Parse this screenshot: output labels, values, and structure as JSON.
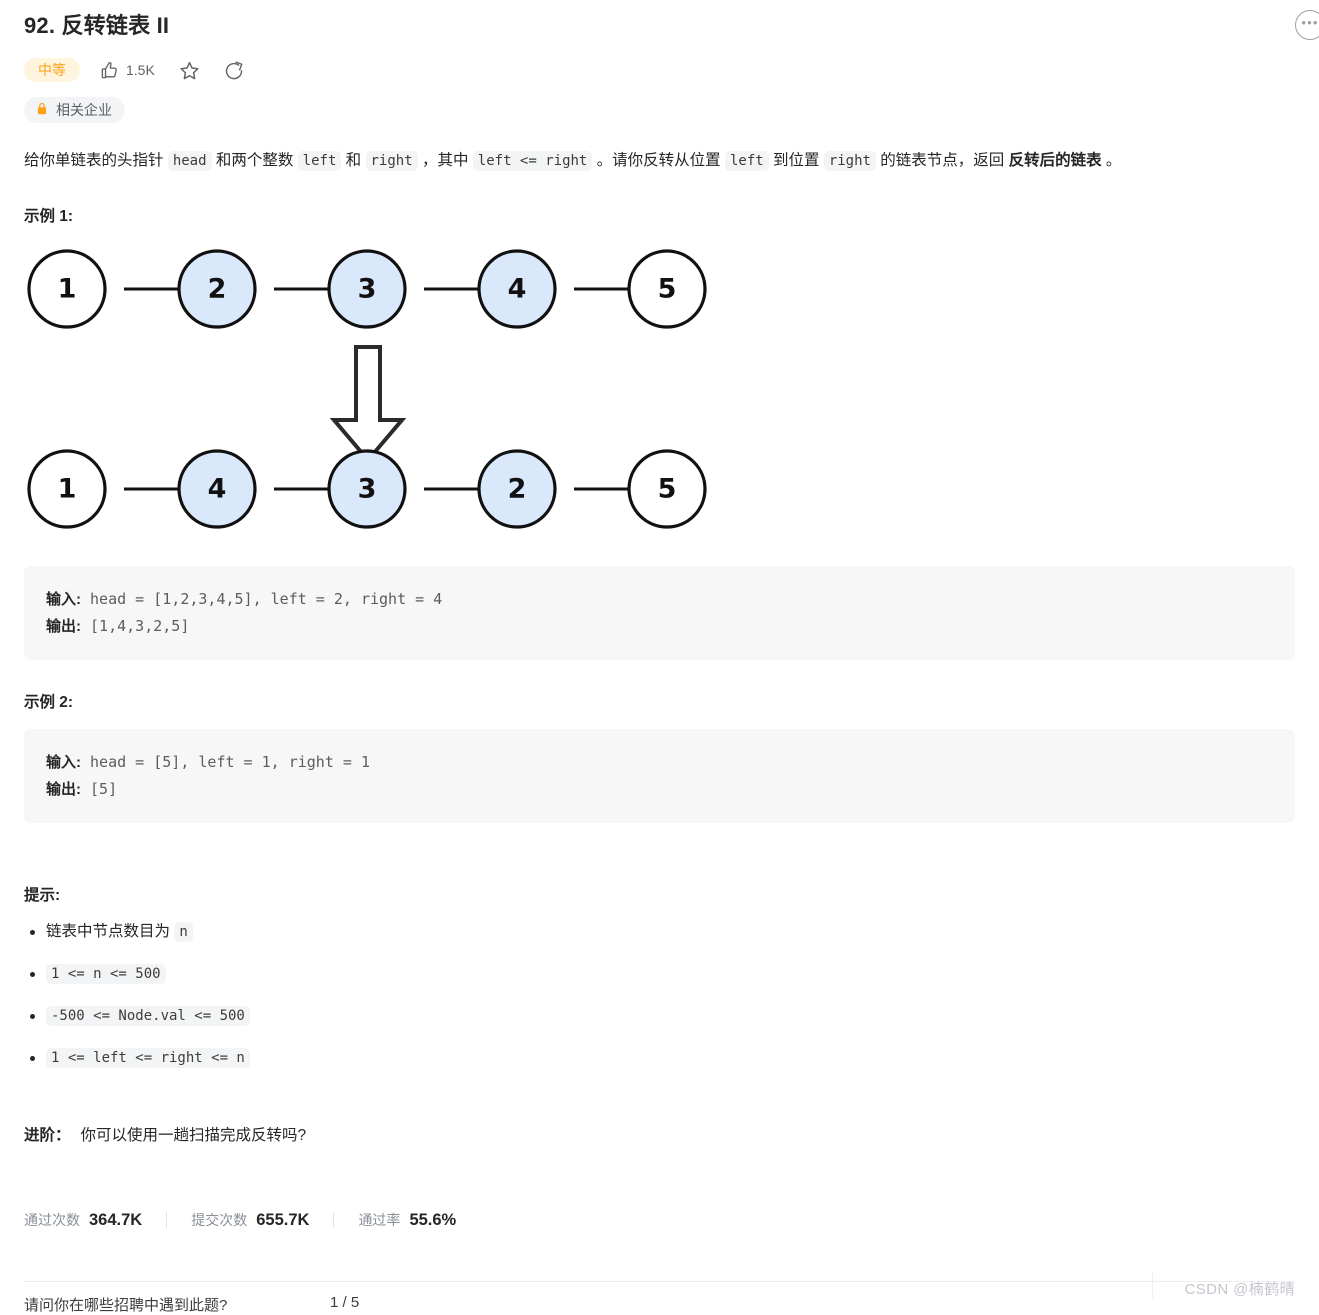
{
  "header": {
    "title": "92. 反转链表 II",
    "difficulty": "中等",
    "like_count": "1.5K",
    "company_tag": "相关企业",
    "more_icon": "ellipsis-circle-icon",
    "like_icon": "thumbs-up-icon",
    "star_icon": "star-icon",
    "share_icon": "share-icon",
    "lock_icon": "lock-icon"
  },
  "description": {
    "seg1": "给你单链表的头指针 ",
    "code_head": "head",
    "seg2": " 和两个整数 ",
    "code_left": "left",
    "seg3": " 和 ",
    "code_right": "right",
    "seg4": " ，其中 ",
    "code_cond": "left <= right",
    "seg5": " 。请你反转从位置 ",
    "code_left2": "left",
    "seg6": " 到位置 ",
    "code_right2": "right",
    "seg7": " 的链表节点，返回 ",
    "bold_tail": "反转后的链表",
    "seg8": " 。"
  },
  "examples": [
    {
      "heading": "示例 1:",
      "input_label": "输入:",
      "input_value": " head = [1,2,3,4,5], left = 2, right = 4",
      "output_label": "输出:",
      "output_value": " [1,4,3,2,5]"
    },
    {
      "heading": "示例 2:",
      "input_label": "输入:",
      "input_value": " head = [5], left = 1, right = 1",
      "output_label": "输出:",
      "output_value": " [5]"
    }
  ],
  "diagram": {
    "top_nodes": [
      "1",
      "2",
      "3",
      "4",
      "5"
    ],
    "top_highlight": [
      false,
      true,
      true,
      true,
      false
    ],
    "bottom_nodes": [
      "1",
      "4",
      "3",
      "2",
      "5"
    ],
    "bottom_highlight": [
      false,
      true,
      true,
      true,
      false
    ],
    "arrow_icon": "down-block-arrow-icon",
    "node_fill_highlight": "#dae8fc",
    "node_fill_plain": "#ffffff",
    "node_stroke": "#1a1a1a"
  },
  "hints": {
    "heading": "提示:",
    "items": [
      {
        "text": "链表中节点数目为 ",
        "code": "n"
      },
      {
        "text": "",
        "code": "1 <= n <= 500"
      },
      {
        "text": "",
        "code": "-500 <= Node.val <= 500"
      },
      {
        "text": "",
        "code": "1 <= left <= right <= n"
      }
    ]
  },
  "followup": {
    "label": "进阶：",
    "text": "你可以使用一趟扫描完成反转吗?"
  },
  "stats": [
    {
      "label": "通过次数",
      "value": "364.7K"
    },
    {
      "label": "提交次数",
      "value": "655.7K"
    },
    {
      "label": "通过率",
      "value": "55.6%"
    }
  ],
  "bottom": {
    "question": "请问你在哪些招聘中遇到此题?",
    "pager": "1 / 5"
  },
  "watermark": "CSDN @楠鹤晴"
}
